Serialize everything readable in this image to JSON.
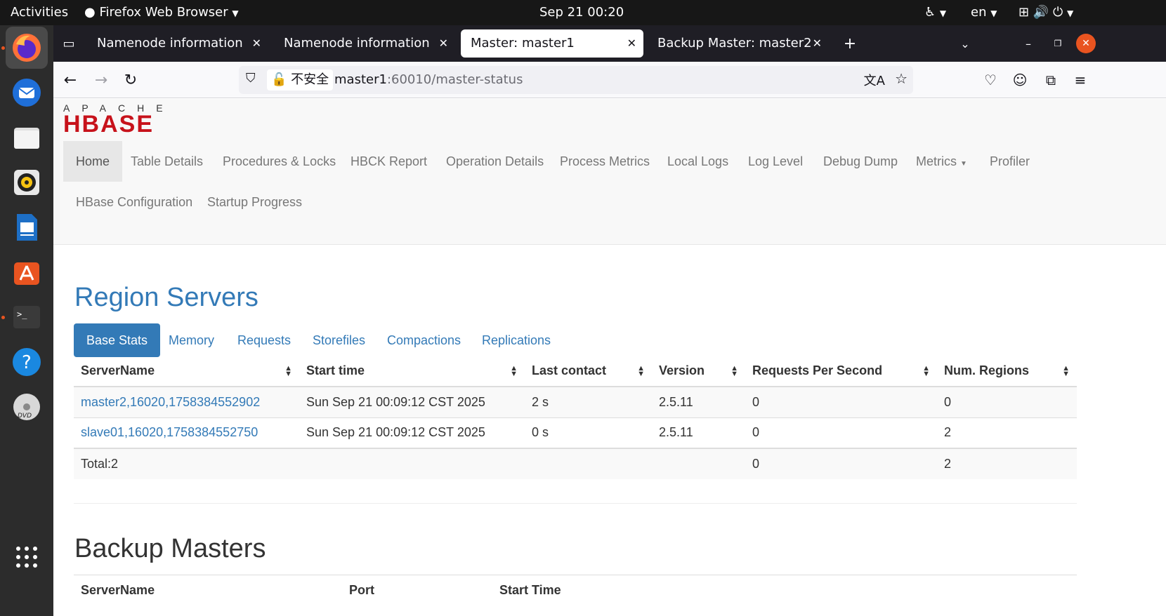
{
  "topbar": {
    "activities": "Activities",
    "app_name": "Firefox Web Browser",
    "clock": "Sep 21  00:20",
    "lang": "en"
  },
  "browser": {
    "tabs": [
      {
        "label": "Namenode information"
      },
      {
        "label": "Namenode information"
      },
      {
        "label": "Master: master1"
      },
      {
        "label": "Backup Master: master2"
      }
    ],
    "new_tab": "+",
    "close": "✕",
    "url_security": "不安全",
    "url_host": "master1",
    "url_path": ":60010/master-status"
  },
  "logo": {
    "top": "APACHE",
    "main": "HBASE"
  },
  "nav": {
    "row1": [
      "Home",
      "Table Details",
      "Procedures & Locks",
      "HBCK Report",
      "Operation Details",
      "Process Metrics",
      "Local Logs",
      "Log Level",
      "Debug Dump",
      "Metrics",
      "Profiler"
    ],
    "row2": [
      "HBase Configuration",
      "Startup Progress"
    ]
  },
  "region_servers": {
    "title": "Region Servers",
    "tabs": [
      "Base Stats",
      "Memory",
      "Requests",
      "Storefiles",
      "Compactions",
      "Replications"
    ],
    "columns": [
      "ServerName",
      "Start time",
      "Last contact",
      "Version",
      "Requests Per Second",
      "Num. Regions"
    ],
    "rows": [
      {
        "server": "master2,16020,1758384552902",
        "start": "Sun Sep 21 00:09:12 CST 2025",
        "contact": "2 s",
        "version": "2.5.11",
        "rps": "0",
        "regions": "0"
      },
      {
        "server": "slave01,16020,1758384552750",
        "start": "Sun Sep 21 00:09:12 CST 2025",
        "contact": "0 s",
        "version": "2.5.11",
        "rps": "0",
        "regions": "2"
      }
    ],
    "total": {
      "label": "Total:2",
      "rps": "0",
      "regions": "2"
    }
  },
  "backup_masters": {
    "title": "Backup Masters",
    "columns": [
      "ServerName",
      "Port",
      "Start Time"
    ]
  },
  "colors": {
    "accent": "#337ab7",
    "ubuntu_orange": "#e95420"
  }
}
